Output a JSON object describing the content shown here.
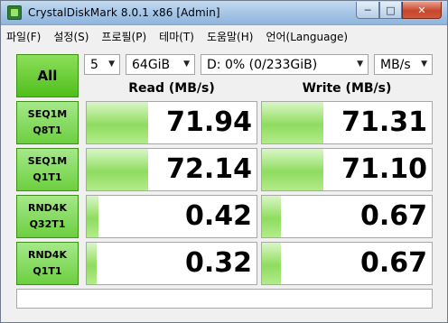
{
  "window": {
    "title": "CrystalDiskMark 8.0.1 x86 [Admin]",
    "buttons": {
      "minimize": "─",
      "maximize": "□",
      "close": "✕"
    }
  },
  "menu": [
    {
      "label": "파일(F)"
    },
    {
      "label": "설정(S)"
    },
    {
      "label": "프로필(P)"
    },
    {
      "label": "테마(T)"
    },
    {
      "label": "도움말(H)"
    },
    {
      "label": "언어(Language)"
    }
  ],
  "controls": {
    "all_label": "All",
    "count": "5",
    "size": "64GiB",
    "drive": "D: 0% (0/233GiB)",
    "unit": "MB/s",
    "arrow": "▼"
  },
  "headers": {
    "read": "Read (MB/s)",
    "write": "Write (MB/s)"
  },
  "tests": [
    {
      "line1": "SEQ1M",
      "line2": "Q8T1",
      "read": "71.94",
      "write": "71.31",
      "read_fill": 0.36,
      "write_fill": 0.36
    },
    {
      "line1": "SEQ1M",
      "line2": "Q1T1",
      "read": "72.14",
      "write": "71.10",
      "read_fill": 0.36,
      "write_fill": 0.36
    },
    {
      "line1": "RND4K",
      "line2": "Q32T1",
      "read": "0.42",
      "write": "0.67",
      "read_fill": 0.07,
      "write_fill": 0.11
    },
    {
      "line1": "RND4K",
      "line2": "Q1T1",
      "read": "0.32",
      "write": "0.67",
      "read_fill": 0.06,
      "write_fill": 0.11
    }
  ],
  "comment": "",
  "colors": {
    "accent_green": "#4fbf1c",
    "bar_green": "#8fdc5f",
    "title_blue": "#a9c8e8"
  }
}
